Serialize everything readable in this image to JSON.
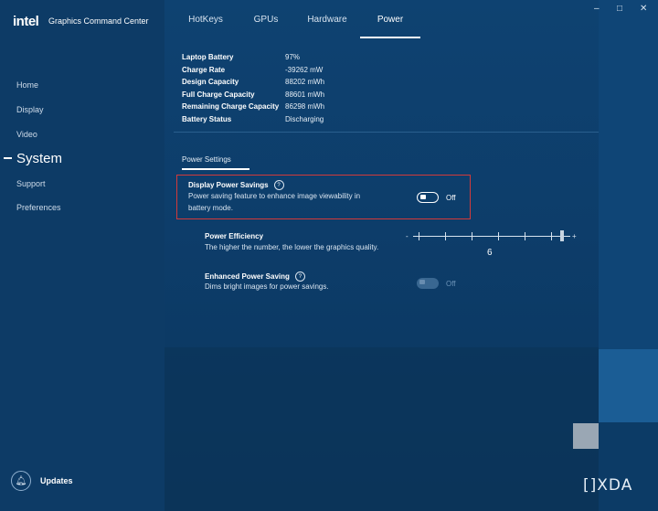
{
  "app": {
    "logo": "intel",
    "title": "Graphics Command Center"
  },
  "window_controls": {
    "minimize": "–",
    "maximize": "□",
    "close": "✕"
  },
  "sidebar": {
    "items": [
      {
        "label": "Home"
      },
      {
        "label": "Display"
      },
      {
        "label": "Video"
      },
      {
        "label": "System"
      },
      {
        "label": "Support"
      },
      {
        "label": "Preferences"
      }
    ],
    "active": "System",
    "updates_label": "Updates"
  },
  "tabs": [
    {
      "label": "HotKeys"
    },
    {
      "label": "GPUs"
    },
    {
      "label": "Hardware"
    },
    {
      "label": "Power"
    }
  ],
  "active_tab": "Power",
  "battery_info": [
    {
      "key": "Laptop Battery",
      "value": "97%"
    },
    {
      "key": "Charge Rate",
      "value": "-39262 mW"
    },
    {
      "key": "Design Capacity",
      "value": "88202 mWh"
    },
    {
      "key": "Full Charge Capacity",
      "value": "88601 mWh"
    },
    {
      "key": "Remaining Charge Capacity",
      "value": "86298 mWh"
    },
    {
      "key": "Battery Status",
      "value": "Discharging"
    }
  ],
  "section_tab": "Power Settings",
  "display_power_savings": {
    "title": "Display Power Savings",
    "desc_line1": "Power saving feature to enhance image viewability in",
    "desc_line2": "battery mode.",
    "toggle_label": "Off",
    "toggle_on": false
  },
  "power_efficiency": {
    "title": "Power Efficiency",
    "desc": "The higher the number, the lower the graphics quality.",
    "minus": "-",
    "plus": "+",
    "value": "6",
    "min": 0,
    "max": 6
  },
  "enhanced_power_saving": {
    "title": "Enhanced Power Saving",
    "desc": "Dims bright images for power savings.",
    "toggle_label": "Off",
    "toggle_on": false,
    "disabled": true
  },
  "watermark": "[]XDA",
  "colors": {
    "background": "#0d3c66",
    "highlight": "#d23a3a",
    "accent": "#ffffff"
  }
}
